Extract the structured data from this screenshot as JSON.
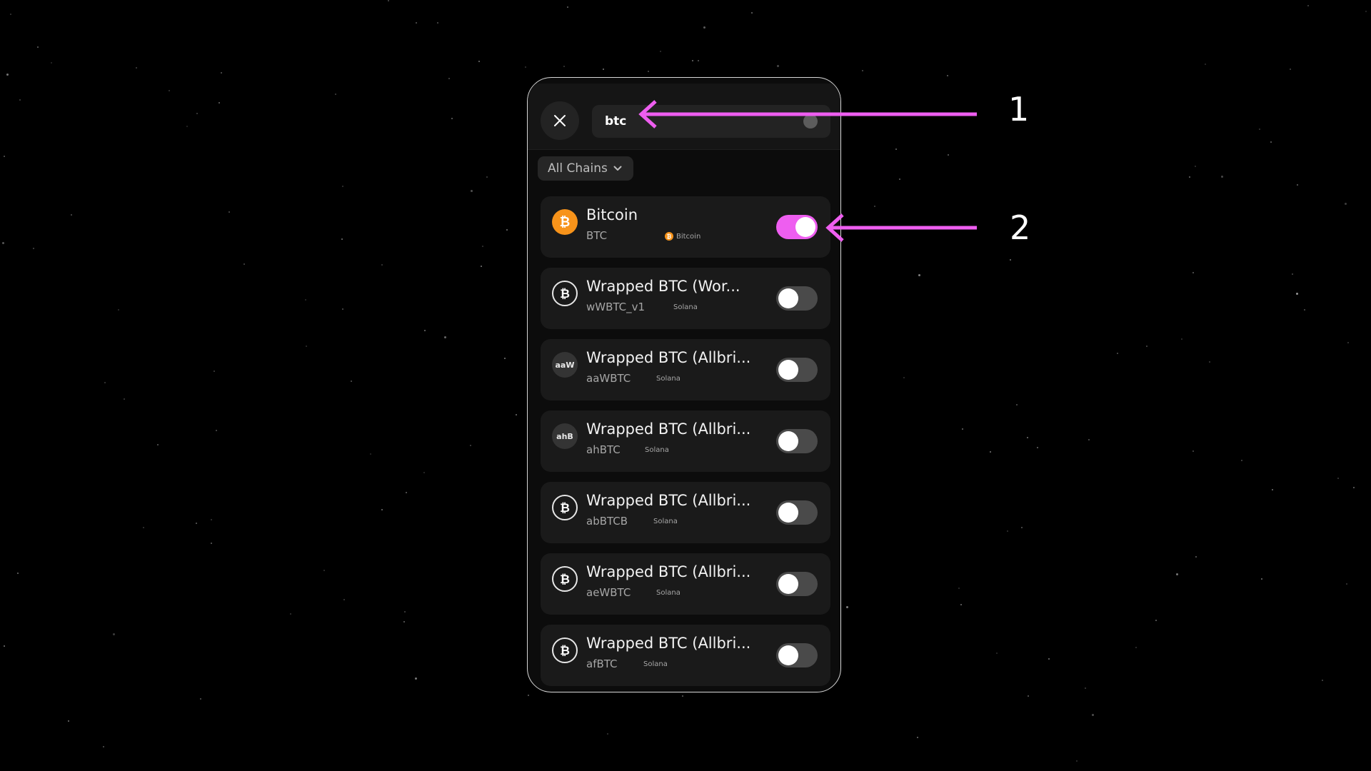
{
  "search": {
    "value": "btc",
    "placeholder": ""
  },
  "filter": {
    "label": "All Chains"
  },
  "tokens": [
    {
      "name": "Bitcoin",
      "symbol": "BTC",
      "chain": "Bitcoin",
      "icon": "bitcoin-icon",
      "enabled": true
    },
    {
      "name": "Wrapped BTC (Wor...",
      "symbol": "wWBTC_v1",
      "chain": "Solana",
      "icon": "bitcoin-outline-icon",
      "enabled": false
    },
    {
      "name": "Wrapped BTC (Allbri...",
      "symbol": "aaWBTC",
      "chain": "Solana",
      "icon_text": "aaW",
      "enabled": false
    },
    {
      "name": "Wrapped BTC (Allbri...",
      "symbol": "ahBTC",
      "chain": "Solana",
      "icon_text": "ahB",
      "enabled": false
    },
    {
      "name": "Wrapped BTC (Allbri...",
      "symbol": "abBTCB",
      "chain": "Solana",
      "icon": "bitcoin-outline-icon",
      "enabled": false
    },
    {
      "name": "Wrapped BTC (Allbri...",
      "symbol": "aeWBTC",
      "chain": "Solana",
      "icon": "bitcoin-outline-icon",
      "enabled": false
    },
    {
      "name": "Wrapped BTC (Allbri...",
      "symbol": "afBTC",
      "chain": "Solana",
      "icon": "bitcoin-outline-icon",
      "enabled": false
    }
  ],
  "annotations": [
    {
      "label": "1"
    },
    {
      "label": "2"
    }
  ],
  "colors": {
    "accent": "#ee5ef0",
    "bitcoin": "#f7931a",
    "background": "#000000"
  }
}
